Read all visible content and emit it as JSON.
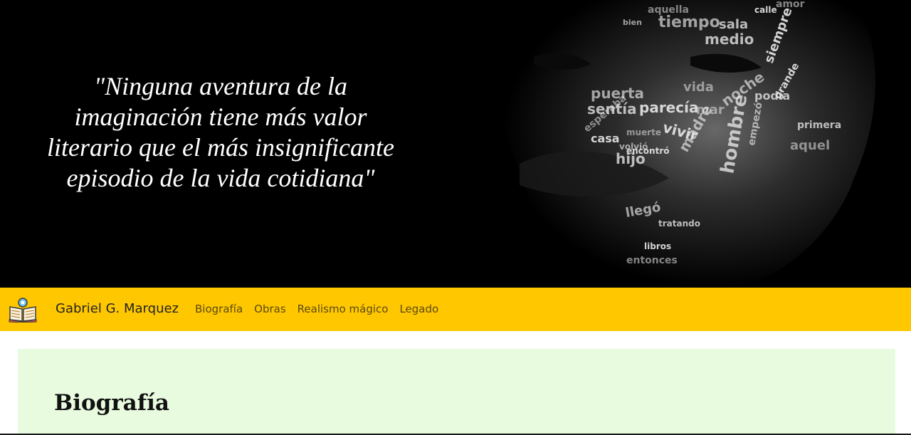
{
  "hero": {
    "quote_lines": [
      "\"Ninguna aventura de la",
      "imaginación tiene más valor",
      "literario que el más insignificante",
      "episodio de la vida cotidiana\""
    ],
    "portrait_words": [
      "aquella",
      "tiempo",
      "sala",
      "calle",
      "amor",
      "bien",
      "medio",
      "siempre",
      "vida",
      "puerta",
      "sentía",
      "parecía",
      "mar",
      "noche",
      "podía",
      "vivir",
      "muerte",
      "madre",
      "hombre",
      "casa",
      "esperaba",
      "volvió",
      "hijo",
      "encontró",
      "aquel",
      "llegó",
      "tratando",
      "libros",
      "entonces",
      "empezó",
      "primera",
      "grande"
    ]
  },
  "navbar": {
    "brand": "Gabriel G. Marquez",
    "links": [
      "Biografía",
      "Obras",
      "Realismo mágico",
      "Legado"
    ]
  },
  "content": {
    "section_title": "Biografía"
  },
  "colors": {
    "hero_bg": "#000000",
    "navbar_bg": "#ffc700",
    "content_bg": "#e8fbdf"
  }
}
